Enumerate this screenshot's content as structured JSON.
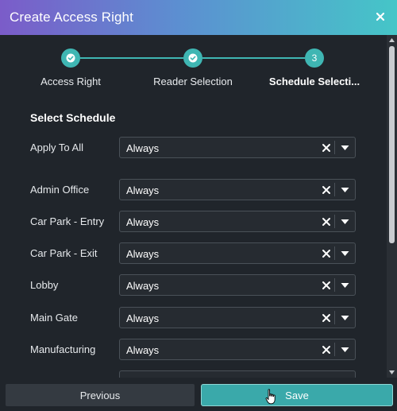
{
  "dialog": {
    "title": "Create Access Right",
    "close_icon": "close-icon"
  },
  "stepper": {
    "steps": [
      {
        "label": "Access Right",
        "state": "completed",
        "icon": "check-icon"
      },
      {
        "label": "Reader Selection",
        "state": "completed",
        "icon": "check-icon"
      },
      {
        "label": "Schedule Selecti...",
        "state": "active",
        "number": "3"
      }
    ]
  },
  "schedule": {
    "section_title": "Select Schedule",
    "apply_all": {
      "label": "Apply To All",
      "value": "Always"
    },
    "rows": [
      {
        "label": "Admin Office",
        "value": "Always"
      },
      {
        "label": "Car Park - Entry",
        "value": "Always"
      },
      {
        "label": "Car Park - Exit",
        "value": "Always"
      },
      {
        "label": "Lobby",
        "value": "Always"
      },
      {
        "label": "Main Gate",
        "value": "Always"
      },
      {
        "label": "Manufacturing",
        "value": "Always"
      }
    ]
  },
  "footer": {
    "previous_label": "Previous",
    "save_label": "Save"
  },
  "colors": {
    "accent": "#3fb6b3",
    "title_gradient_start": "#7b5cc9",
    "title_gradient_end": "#45c6c8",
    "background": "#20252b"
  }
}
